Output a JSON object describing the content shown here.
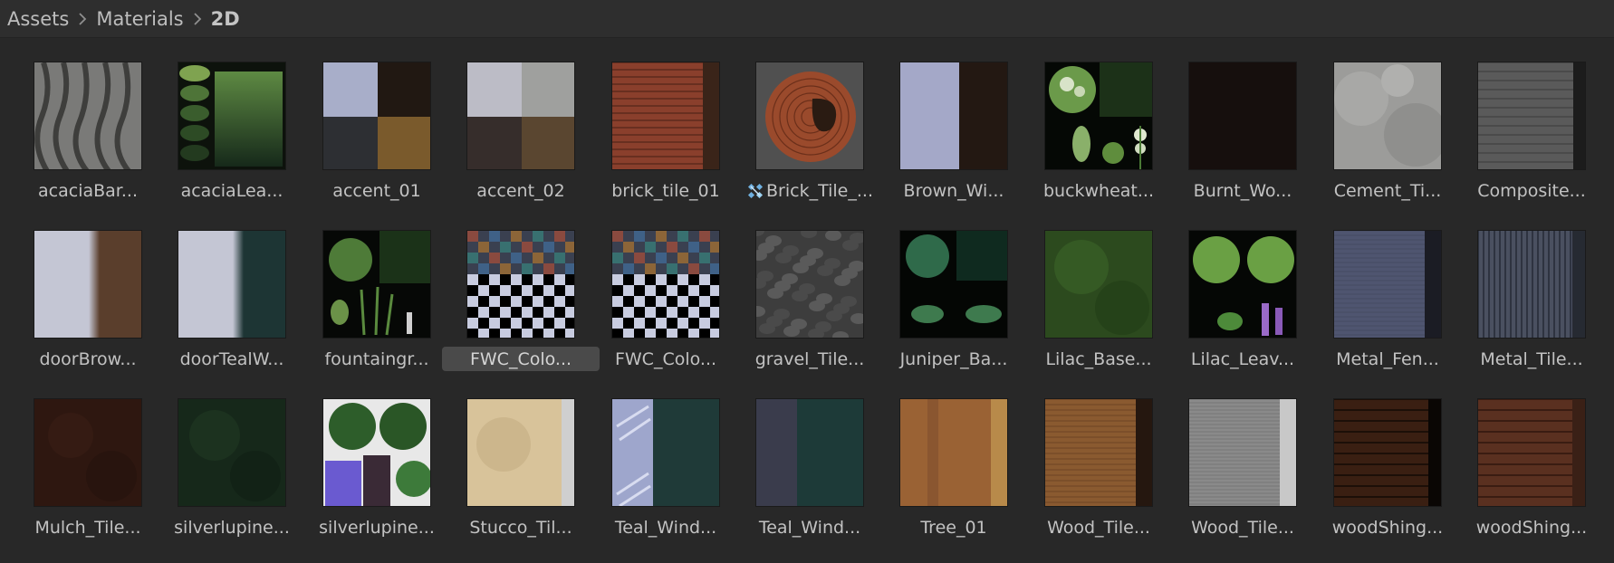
{
  "breadcrumb": {
    "items": [
      "Assets",
      "Materials",
      "2D"
    ]
  },
  "assets": [
    {
      "name": "acaciaBar...",
      "icon": "bark-texture-thumbnail"
    },
    {
      "name": "acaciaLea...",
      "icon": "leaf-texture-thumbnail"
    },
    {
      "name": "accent_01",
      "icon": "color-swatch-thumbnail"
    },
    {
      "name": "accent_02",
      "icon": "color-swatch-thumbnail"
    },
    {
      "name": "brick_tile_01",
      "icon": "brick-texture-thumbnail"
    },
    {
      "name": "Brick_Tile_...",
      "icon": "brick-circle-thumbnail",
      "badge": "prefab-variant-icon"
    },
    {
      "name": "Brown_Wi...",
      "icon": "color-swatch-thumbnail"
    },
    {
      "name": "buckwheat...",
      "icon": "plant-atlas-thumbnail"
    },
    {
      "name": "Burnt_Wo...",
      "icon": "dark-texture-thumbnail"
    },
    {
      "name": "Cement_Ti...",
      "icon": "cement-texture-thumbnail"
    },
    {
      "name": "Composite...",
      "icon": "shingle-texture-thumbnail"
    },
    {
      "name": "doorBrow...",
      "icon": "color-swatch-thumbnail"
    },
    {
      "name": "doorTealW...",
      "icon": "color-swatch-thumbnail"
    },
    {
      "name": "fountaingr...",
      "icon": "plant-atlas-thumbnail"
    },
    {
      "name": "FWC_Colo...",
      "icon": "checker-thumbnail",
      "selected": true
    },
    {
      "name": "FWC_Colo...",
      "icon": "checker-thumbnail"
    },
    {
      "name": "gravel_Tile...",
      "icon": "gravel-texture-thumbnail"
    },
    {
      "name": "Juniper_Ba...",
      "icon": "plant-atlas-thumbnail"
    },
    {
      "name": "Lilac_Base...",
      "icon": "grass-texture-thumbnail"
    },
    {
      "name": "Lilac_Leav...",
      "icon": "plant-atlas-thumbnail"
    },
    {
      "name": "Metal_Fen...",
      "icon": "metal-texture-thumbnail"
    },
    {
      "name": "Metal_Tile...",
      "icon": "metal-texture-thumbnail"
    },
    {
      "name": "Mulch_Tile...",
      "icon": "mulch-texture-thumbnail"
    },
    {
      "name": "silverlupine...",
      "icon": "grass-texture-thumbnail"
    },
    {
      "name": "silverlupine...",
      "icon": "plant-atlas-thumbnail"
    },
    {
      "name": "Stucco_Til...",
      "icon": "stucco-texture-thumbnail"
    },
    {
      "name": "Teal_Wind...",
      "icon": "window-texture-thumbnail"
    },
    {
      "name": "Teal_Wind...",
      "icon": "window-texture-thumbnail"
    },
    {
      "name": "Tree_01",
      "icon": "wood-texture-thumbnail"
    },
    {
      "name": "Wood_Tile...",
      "icon": "wood-texture-thumbnail"
    },
    {
      "name": "Wood_Tile...",
      "icon": "wood-texture-thumbnail"
    },
    {
      "name": "woodShing...",
      "icon": "shingle-texture-thumbnail"
    },
    {
      "name": "woodShing...",
      "icon": "shingle-texture-thumbnail"
    }
  ],
  "colors": {
    "background": "#282828",
    "breadcrumb_bar": "#2e2e2e",
    "selection": "#4a4a4a"
  }
}
